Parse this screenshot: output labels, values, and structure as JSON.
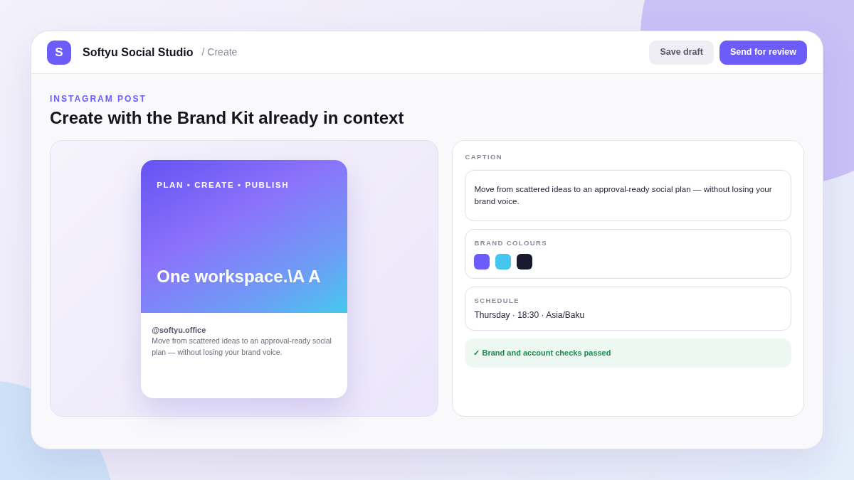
{
  "app": {
    "logo_letter": "S",
    "name": "Softyu Social Studio",
    "breadcrumb": "/ Create"
  },
  "actions": [
    {
      "label": "Save draft",
      "kind": "secondary"
    },
    {
      "label": "Send for review",
      "kind": "primary"
    }
  ],
  "page": {
    "eyebrow": "INSTAGRAM POST",
    "title": "Create with the Brand Kit already in context"
  },
  "preview": {
    "tagline": "PLAN • CREATE • PUBLISH",
    "headline": "One workspace.\\A A",
    "handle": "@softyu.office",
    "caption": "Move from scattered ideas to an approval-ready social plan — without losing your brand voice."
  },
  "caption_panel": {
    "label": "CAPTION",
    "text": "Move from scattered ideas to an approval-ready social plan — without losing your brand voice."
  },
  "brand_colours": {
    "label": "BRAND COLOURS",
    "swatches": [
      {
        "color": "#6c5cfa"
      },
      {
        "color": "#45c6ee"
      },
      {
        "color": "#1a1a2e"
      }
    ]
  },
  "schedule": {
    "label": "SCHEDULE",
    "value": "Thursday · 18:30 · Asia/Baku"
  },
  "check": {
    "text": "✓ Brand and account checks passed",
    "passed": true
  }
}
